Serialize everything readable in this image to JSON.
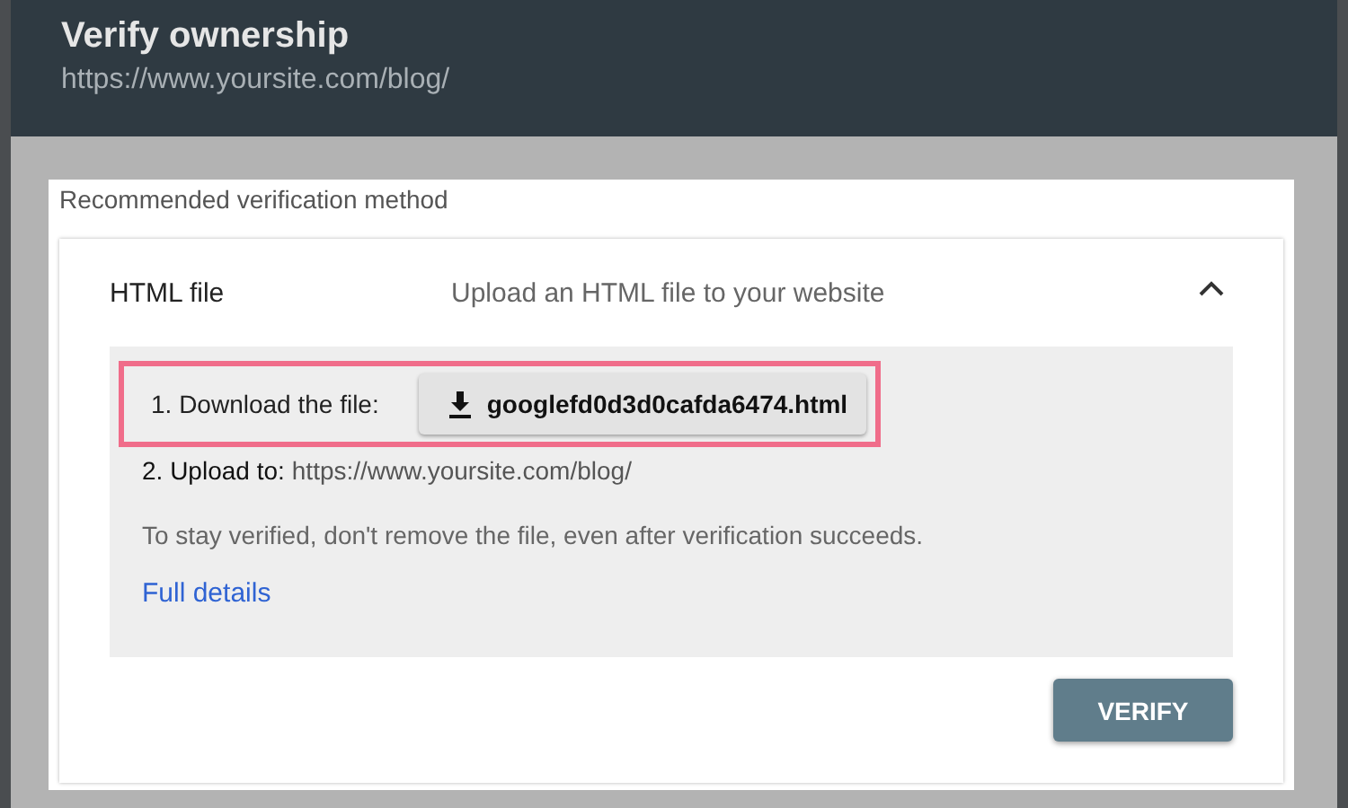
{
  "dialog": {
    "title": "Verify ownership",
    "subtitle": "https://www.yoursite.com/blog/"
  },
  "section_label": "Recommended verification method",
  "method": {
    "name": "HTML file",
    "description": "Upload an HTML file to your website",
    "expanded": true,
    "step_1": {
      "label": "1. Download the file:",
      "file_button": "googlefd0d3d0cafda6474.html",
      "highlighted": true
    },
    "step_2": {
      "label": "2. Upload to:",
      "url": "https://www.yoursite.com/blog/"
    },
    "note": "To stay verified, don't remove the file, even after verification succeeds.",
    "link": "Full details"
  },
  "verify_button": "VERIFY"
}
